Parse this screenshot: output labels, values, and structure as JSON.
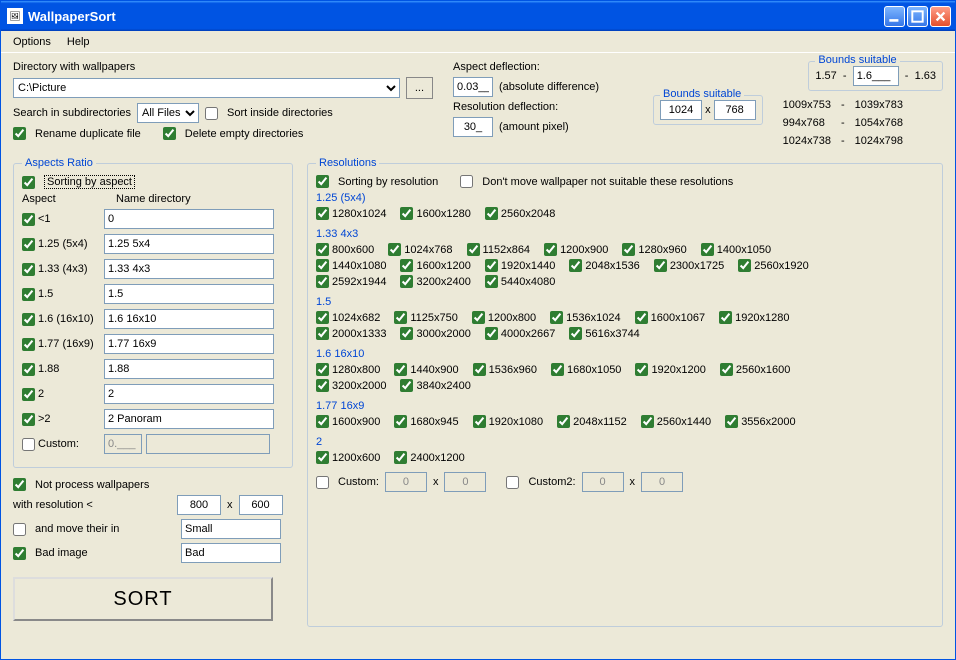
{
  "window": {
    "title": "WallpaperSort"
  },
  "menu": {
    "options": "Options",
    "help": "Help"
  },
  "labels": {
    "directory": "Directory with wallpapers",
    "browse": "...",
    "search_sub": "Search in subdirectories",
    "all_files": "All Files",
    "sort_inside": "Sort inside directories",
    "rename_dup": "Rename duplicate file",
    "del_empty": "Delete empty directories",
    "aspect_def": "Aspect deflection:",
    "abs_diff": "(absolute difference)",
    "res_def": "Resolution deflection:",
    "amount_px": "(amount pixel)",
    "bounds": "Bounds suitable",
    "x": "x",
    "aspects_ratio": "Aspects Ratio",
    "sort_by_aspect": "Sorting by aspect",
    "aspect": "Aspect",
    "name_dir": "Name directory",
    "custom": "Custom:",
    "not_process": "Not process wallpapers",
    "with_res": "with resolution <",
    "and_move": "and move their in",
    "bad_image": "Bad image",
    "sort": "SORT",
    "resolutions": "Resolutions",
    "sort_by_res": "Sorting by resolution",
    "dont_move": "Don't move wallpaper not suitable these resolutions",
    "custom2": "Custom2:"
  },
  "values": {
    "directory": "C:\\Picture",
    "aspect_def": "0.03__",
    "res_def": "30_",
    "bounds_aspect_lo": "1.57",
    "bounds_aspect_mid": "1.6___",
    "bounds_aspect_hi": "1.63",
    "bounds_w": "1024",
    "bounds_h": "768",
    "not_process_w": "800",
    "not_process_h": "600",
    "move_dir": "Small",
    "bad_dir": "Bad",
    "custom_val": "0.___",
    "custom_res_w": "0",
    "custom_res_h": "0",
    "custom2_w": "0",
    "custom2_h": "0"
  },
  "bounds_pairs": [
    [
      "1009x753",
      "1039x783"
    ],
    [
      "994x768",
      "1054x768"
    ],
    [
      "1024x738",
      "1024x798"
    ]
  ],
  "aspects": [
    {
      "label": "<1",
      "name": "0",
      "checked": true
    },
    {
      "label": "1.25 (5x4)",
      "name": "1.25 5x4",
      "checked": true
    },
    {
      "label": "1.33 (4x3)",
      "name": "1.33 4x3",
      "checked": true
    },
    {
      "label": "1.5",
      "name": "1.5",
      "checked": true
    },
    {
      "label": "1.6 (16x10)",
      "name": "1.6 16x10",
      "checked": true
    },
    {
      "label": "1.77 (16x9)",
      "name": "1.77 16x9",
      "checked": true
    },
    {
      "label": "1.88",
      "name": "1.88",
      "checked": true
    },
    {
      "label": "2",
      "name": "2",
      "checked": true
    },
    {
      "label": ">2",
      "name": "2 Panoram",
      "checked": true
    }
  ],
  "res_groups": [
    {
      "title": "1.25 (5x4)",
      "lines": [
        [
          "1280x1024",
          "1600x1280",
          "2560x2048"
        ]
      ]
    },
    {
      "title": "1.33 4x3",
      "lines": [
        [
          "800x600",
          "1024x768",
          "1152x864",
          "1200x900",
          "1280x960",
          "1400x1050"
        ],
        [
          "1440x1080",
          "1600x1200",
          "1920x1440",
          "2048x1536",
          "2300x1725",
          "2560x1920"
        ],
        [
          "2592x1944",
          "3200x2400",
          "5440x4080"
        ]
      ]
    },
    {
      "title": "1.5",
      "lines": [
        [
          "1024x682",
          "1125x750",
          "1200x800",
          "1536x1024",
          "1600x1067",
          "1920x1280"
        ],
        [
          "2000x1333",
          "3000x2000",
          "4000x2667",
          "5616x3744"
        ]
      ]
    },
    {
      "title": "1.6 16x10",
      "lines": [
        [
          "1280x800",
          "1440x900",
          "1536x960",
          "1680x1050",
          "1920x1200",
          "2560x1600"
        ],
        [
          "3200x2000",
          "3840x2400"
        ]
      ]
    },
    {
      "title": "1.77 16x9",
      "lines": [
        [
          "1600x900",
          "1680x945",
          "1920x1080",
          "2048x1152",
          "2560x1440",
          "3556x2000"
        ]
      ]
    },
    {
      "title": "2",
      "lines": [
        [
          "1200x600",
          "2400x1200"
        ]
      ]
    }
  ]
}
